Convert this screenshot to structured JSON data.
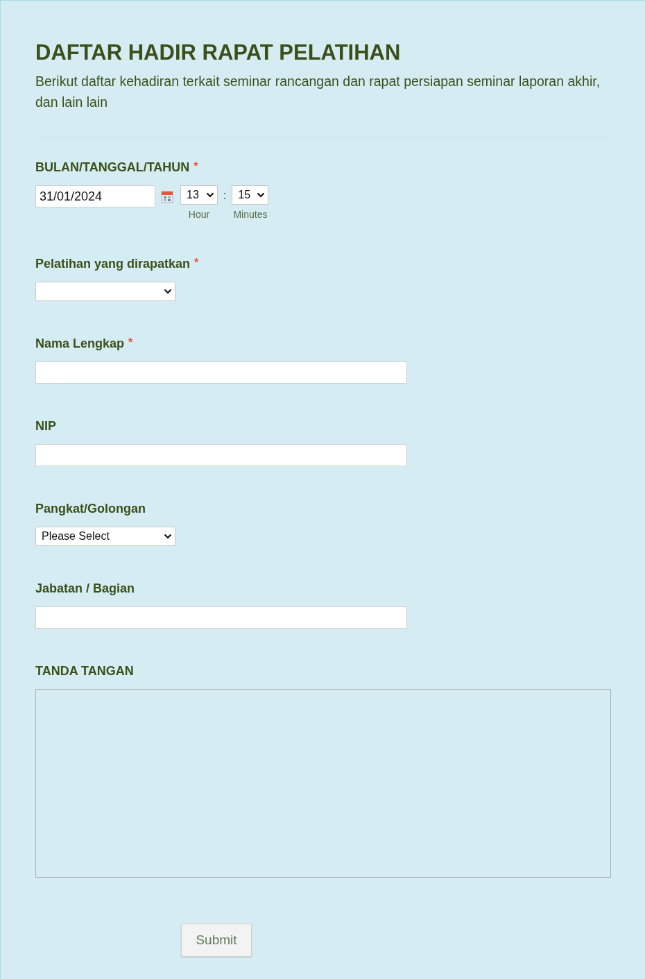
{
  "form": {
    "title": "DAFTAR HADIR RAPAT PELATIHAN",
    "description": "Berikut daftar kehadiran terkait seminar rancangan dan rapat persiapan seminar laporan akhir, dan lain lain",
    "fields": [
      {
        "kind": "datetime",
        "label": "BULAN/TANGGAL/TAHUN",
        "required_mark": "*",
        "value": "31/01/2024",
        "hour": "13",
        "minute": "15",
        "separator": ":",
        "hour_label": "Hour",
        "minute_label": "Minutes"
      },
      {
        "kind": "select",
        "label": "Pelatihan yang dirapatkan",
        "required_mark": "*"
      },
      {
        "kind": "text",
        "label": "Nama Lengkap",
        "required_mark": "*"
      },
      {
        "kind": "text",
        "label": "NIP"
      },
      {
        "kind": "select",
        "label": "Pangkat/Golongan",
        "value": "Please Select"
      },
      {
        "kind": "text",
        "label": "Jabatan / Bagian"
      },
      {
        "kind": "signature",
        "label": "TANDA TANGAN"
      }
    ],
    "submit": "Submit"
  }
}
